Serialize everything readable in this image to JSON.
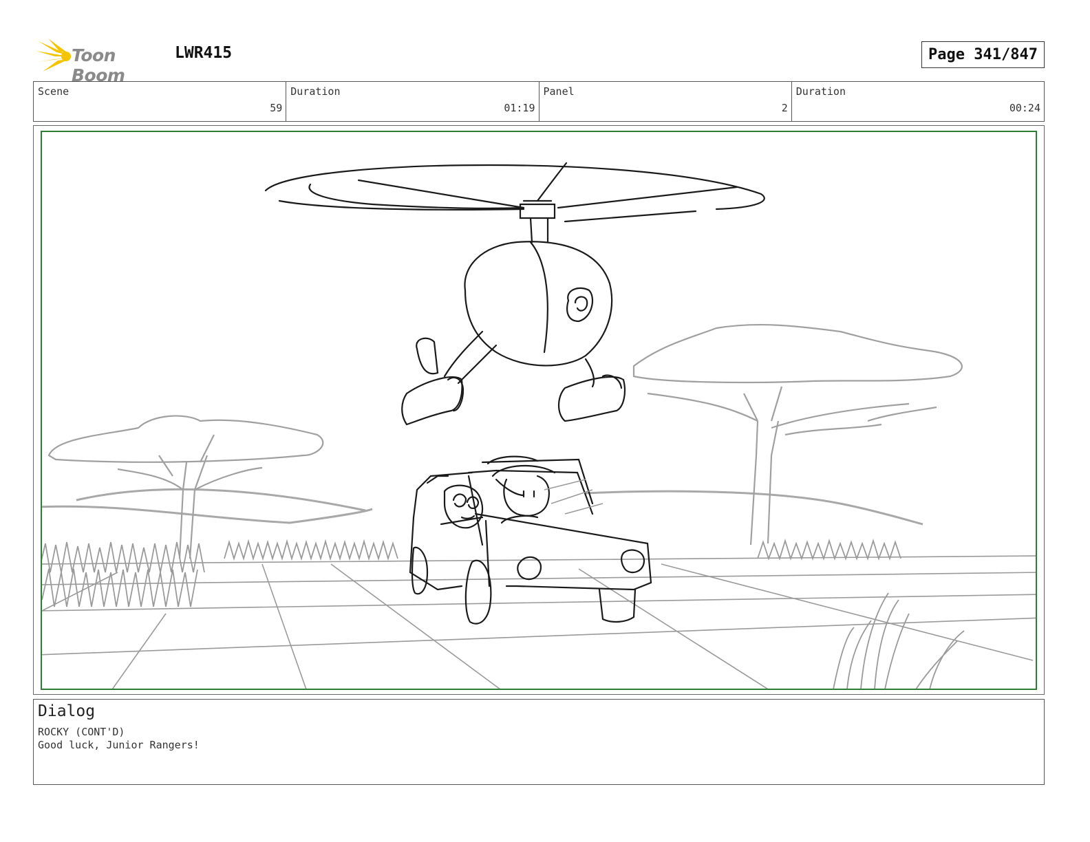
{
  "header": {
    "logo_text": "Toon Boom",
    "project_code": "LWR415",
    "page_label": "Page 341/847"
  },
  "info_bar": [
    {
      "label": "Scene",
      "value": "59"
    },
    {
      "label": "Duration",
      "value": "01:19"
    },
    {
      "label": "Panel",
      "value": "2"
    },
    {
      "label": "Duration",
      "value": "00:24"
    }
  ],
  "dialog": {
    "title": "Dialog",
    "lines": [
      "ROCKY (CONT'D)",
      "Good luck, Junior Rangers!"
    ]
  },
  "colors": {
    "panel_border": "#2e7d32",
    "logo_accent": "#f5c400"
  }
}
